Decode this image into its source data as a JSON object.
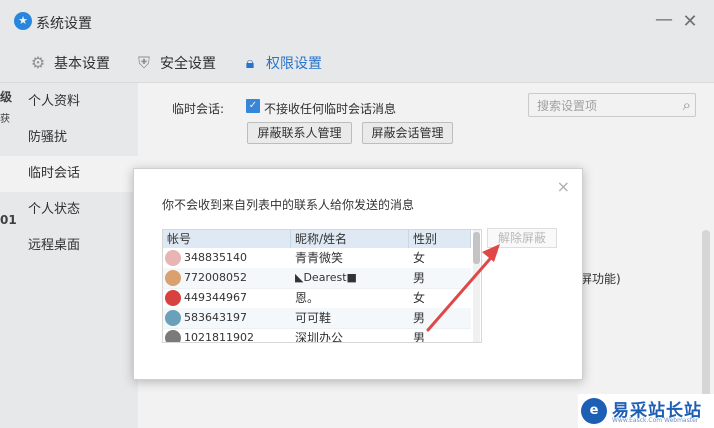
{
  "window": {
    "title": "系统设置",
    "minimize": "—",
    "close": "✕"
  },
  "tabs": [
    {
      "label": "基本设置",
      "icon": "gear-icon"
    },
    {
      "label": "安全设置",
      "icon": "shield-icon"
    },
    {
      "label": "权限设置",
      "icon": "lock-icon",
      "active": true
    }
  ],
  "search": {
    "placeholder": "搜索设置项",
    "value": ""
  },
  "sidebar": {
    "items": [
      {
        "label": "个人资料"
      },
      {
        "label": "防骚扰"
      },
      {
        "label": "临时会话",
        "active": true
      },
      {
        "label": "个人状态"
      },
      {
        "label": "远程桌面"
      }
    ],
    "clipped_marks": [
      "级",
      "获",
      "01"
    ]
  },
  "main": {
    "field_label": "临时会话:",
    "checkbox_label": "不接收任何临时会话消息",
    "checkbox_checked": true,
    "buttons": [
      "屏蔽联系人管理",
      "屏蔽会话管理"
    ],
    "background_text": "锁屏功能)"
  },
  "dialog": {
    "message": "你不会收到来自列表中的联系人给你发送的消息",
    "close": "×",
    "columns": [
      "帐号",
      "昵称/姓名",
      "性别"
    ],
    "rows": [
      {
        "account": "348835140",
        "name": "青青微笑",
        "gender": "女",
        "avatar_color": "#e8b4b4"
      },
      {
        "account": "772008052",
        "name": "◣Dearest■",
        "gender": "男",
        "avatar_color": "#d9a070"
      },
      {
        "account": "449344967",
        "name": "恩。",
        "gender": "女",
        "avatar_color": "#d94040"
      },
      {
        "account": "583643197",
        "name": "可可鞋",
        "gender": "男",
        "avatar_color": "#6aa0b8"
      },
      {
        "account": "1021811902",
        "name": "深圳办公",
        "gender": "男",
        "avatar_color": "#7a7a7a"
      }
    ],
    "unblock_label": "解除屏蔽",
    "arrow_color": "#e04848"
  },
  "watermark": {
    "name": "易采站长站",
    "sub": "Www.Easck.Com Webmaster",
    "mark": "e"
  }
}
